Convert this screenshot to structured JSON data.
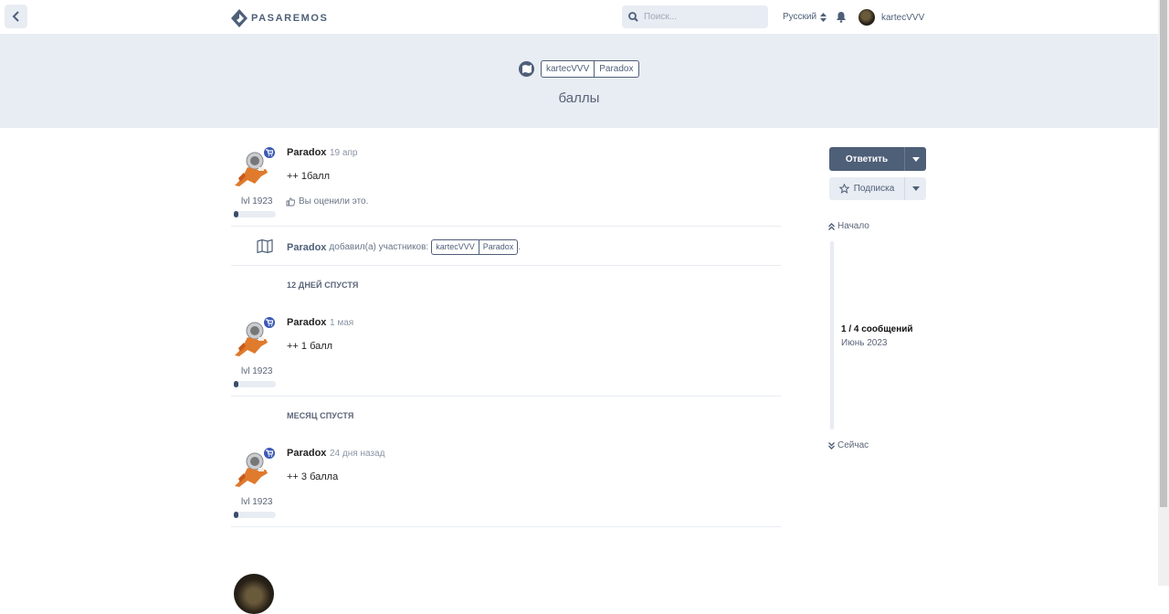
{
  "header": {
    "logo_text": "PASAREMOS",
    "search_placeholder": "Поиск...",
    "language": "Русский",
    "username": "kartecVVV"
  },
  "discussion": {
    "tags": [
      "kartecVVV",
      "Paradox"
    ],
    "title": "баллы"
  },
  "posts": [
    {
      "author": "Paradox",
      "time": "19 апр",
      "body": "++ 1балл",
      "level": "lvl 1923",
      "level_progress": 0.1,
      "liked_text": "Вы оценили это."
    },
    {
      "author": "Paradox",
      "time": "1 мая",
      "body": "++ 1 балл",
      "level": "lvl 1923",
      "level_progress": 0.1
    },
    {
      "author": "Paradox",
      "time": "24 дня назад",
      "body": "++ 3 балла",
      "level": "lvl 1923",
      "level_progress": 0.1
    }
  ],
  "event": {
    "author": "Paradox",
    "text": "добавил(а) участников:",
    "tags": [
      "kartecVVV",
      "Paradox"
    ],
    "suffix": "."
  },
  "gaps": [
    "12 ДНЕЙ СПУСТЯ",
    "МЕСЯЦ СПУСТЯ"
  ],
  "sidebar": {
    "reply_label": "Ответить",
    "subscribe_label": "Подписка",
    "start_label": "Начало",
    "count_label": "1 / 4 сообщений",
    "date_label": "Июнь 2023",
    "now_label": "Сейчас"
  },
  "colors": {
    "accent": "#4e5f78",
    "hero_bg": "#e8ecf3",
    "badge": "#3c5ab4"
  }
}
